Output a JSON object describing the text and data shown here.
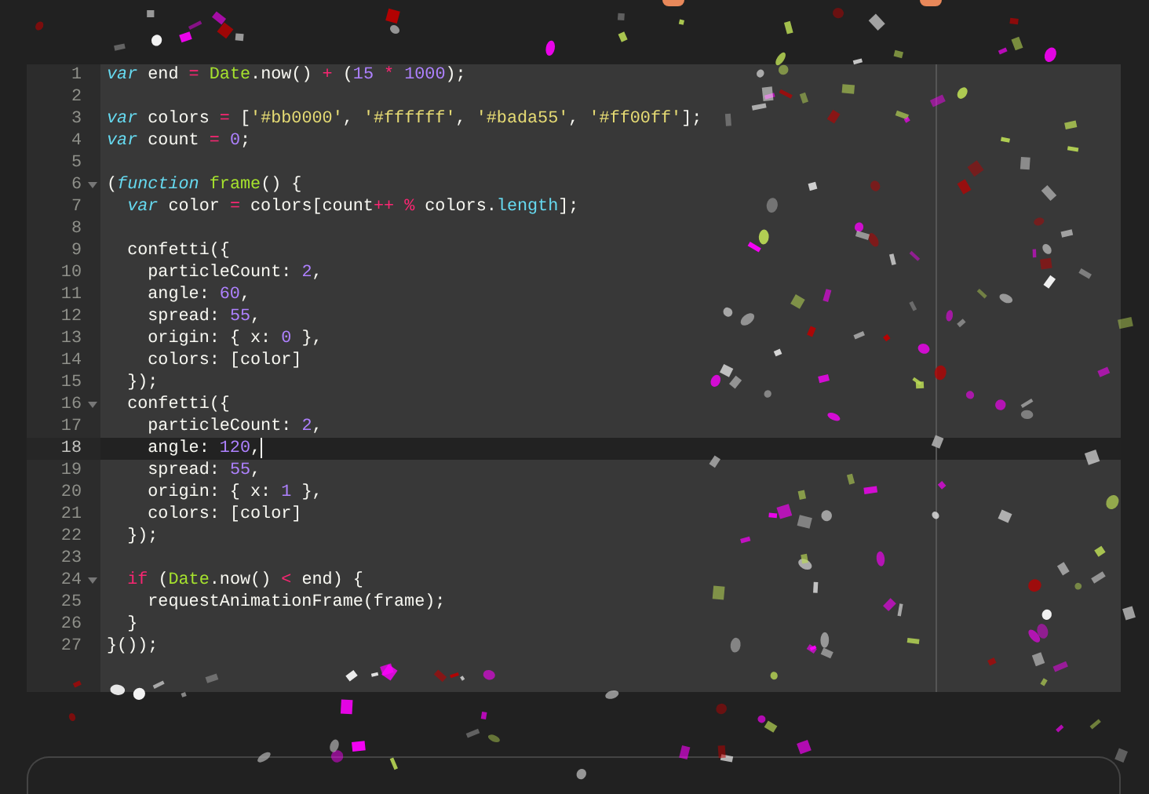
{
  "editor": {
    "lines": [
      {
        "number": "1",
        "active": false,
        "foldable": false,
        "tokens": [
          {
            "text": "var",
            "kind": "kw"
          },
          {
            "text": " end ",
            "kind": "plain"
          },
          {
            "text": "= ",
            "kind": "op"
          },
          {
            "text": "Date",
            "kind": "cls"
          },
          {
            "text": ".now() ",
            "kind": "plain"
          },
          {
            "text": "+",
            "kind": "op"
          },
          {
            "text": " (",
            "kind": "plain"
          },
          {
            "text": "15 ",
            "kind": "num"
          },
          {
            "text": "* ",
            "kind": "op"
          },
          {
            "text": "1000",
            "kind": "num"
          },
          {
            "text": ");",
            "kind": "plain"
          }
        ]
      },
      {
        "number": "2",
        "active": false,
        "foldable": false
      },
      {
        "number": "3",
        "active": false,
        "foldable": false,
        "tokens": [
          {
            "text": "var",
            "kind": "kw"
          },
          {
            "text": " colors ",
            "kind": "plain"
          },
          {
            "text": "=",
            "kind": "op"
          },
          {
            "text": " [",
            "kind": "plain"
          },
          {
            "text": "'#bb0000'",
            "kind": "str"
          },
          {
            "text": ", ",
            "kind": "plain"
          },
          {
            "text": "'#ffffff'",
            "kind": "str"
          },
          {
            "text": ", ",
            "kind": "plain"
          },
          {
            "text": "'#bada55'",
            "kind": "str"
          },
          {
            "text": ", ",
            "kind": "plain"
          },
          {
            "text": "'#ff00ff'",
            "kind": "str"
          },
          {
            "text": "];",
            "kind": "plain"
          }
        ]
      },
      {
        "number": "4",
        "active": false,
        "foldable": false,
        "tokens": [
          {
            "text": "var",
            "kind": "kw"
          },
          {
            "text": " count ",
            "kind": "plain"
          },
          {
            "text": "= ",
            "kind": "op"
          },
          {
            "text": "0",
            "kind": "num"
          },
          {
            "text": ";",
            "kind": "plain"
          }
        ]
      },
      {
        "number": "5",
        "active": false,
        "foldable": false
      },
      {
        "number": "6",
        "active": false,
        "foldable": true,
        "tokens": [
          {
            "text": "(",
            "kind": "plain"
          },
          {
            "text": "function ",
            "kind": "kw"
          },
          {
            "text": "frame",
            "kind": "fn"
          },
          {
            "text": "() {",
            "kind": "plain"
          }
        ]
      },
      {
        "number": "7",
        "active": false,
        "foldable": false,
        "tokens": [
          {
            "text": "  var",
            "kind": "kw"
          },
          {
            "text": " color ",
            "kind": "plain"
          },
          {
            "text": "=",
            "kind": "op"
          },
          {
            "text": " colors[count",
            "kind": "plain"
          },
          {
            "text": "++ ",
            "kind": "op"
          },
          {
            "text": "%",
            "kind": "op"
          },
          {
            "text": " colors.",
            "kind": "plain"
          },
          {
            "text": "length",
            "kind": "prop"
          },
          {
            "text": "];",
            "kind": "plain"
          }
        ]
      },
      {
        "number": "8",
        "active": false,
        "foldable": false
      },
      {
        "number": "9",
        "active": false,
        "foldable": false,
        "tokens": [
          {
            "text": "  confetti({",
            "kind": "plain"
          }
        ]
      },
      {
        "number": "10",
        "active": false,
        "foldable": false,
        "tokens": [
          {
            "text": "    particleCount: ",
            "kind": "plain"
          },
          {
            "text": "2",
            "kind": "num"
          },
          {
            "text": ",",
            "kind": "plain"
          }
        ]
      },
      {
        "number": "11",
        "active": false,
        "foldable": false,
        "tokens": [
          {
            "text": "    angle: ",
            "kind": "plain"
          },
          {
            "text": "60",
            "kind": "num"
          },
          {
            "text": ",",
            "kind": "plain"
          }
        ]
      },
      {
        "number": "12",
        "active": false,
        "foldable": false,
        "tokens": [
          {
            "text": "    spread: ",
            "kind": "plain"
          },
          {
            "text": "55",
            "kind": "num"
          },
          {
            "text": ",",
            "kind": "plain"
          }
        ]
      },
      {
        "number": "13",
        "active": false,
        "foldable": false,
        "tokens": [
          {
            "text": "    origin: { x: ",
            "kind": "plain"
          },
          {
            "text": "0",
            "kind": "num"
          },
          {
            "text": " },",
            "kind": "plain"
          }
        ]
      },
      {
        "number": "14",
        "active": false,
        "foldable": false,
        "tokens": [
          {
            "text": "    colors: [color]",
            "kind": "plain"
          }
        ]
      },
      {
        "number": "15",
        "active": false,
        "foldable": false,
        "tokens": [
          {
            "text": "  });",
            "kind": "plain"
          }
        ]
      },
      {
        "number": "16",
        "active": false,
        "foldable": true,
        "tokens": [
          {
            "text": "  confetti({",
            "kind": "plain"
          }
        ]
      },
      {
        "number": "17",
        "active": false,
        "foldable": false,
        "tokens": [
          {
            "text": "    particleCount: ",
            "kind": "plain"
          },
          {
            "text": "2",
            "kind": "num"
          },
          {
            "text": ",",
            "kind": "plain"
          }
        ]
      },
      {
        "number": "18",
        "active": true,
        "foldable": false,
        "tokens": [
          {
            "text": "    angle: ",
            "kind": "plain"
          },
          {
            "text": "120",
            "kind": "num"
          },
          {
            "text": ",",
            "kind": "plain"
          }
        ]
      },
      {
        "number": "19",
        "active": false,
        "foldable": false,
        "tokens": [
          {
            "text": "    spread: ",
            "kind": "plain"
          },
          {
            "text": "55",
            "kind": "num"
          },
          {
            "text": ",",
            "kind": "plain"
          }
        ]
      },
      {
        "number": "20",
        "active": false,
        "foldable": false,
        "tokens": [
          {
            "text": "    origin: { x: ",
            "kind": "plain"
          },
          {
            "text": "1",
            "kind": "num"
          },
          {
            "text": " },",
            "kind": "plain"
          }
        ]
      },
      {
        "number": "21",
        "active": false,
        "foldable": false,
        "tokens": [
          {
            "text": "    colors: [color]",
            "kind": "plain"
          }
        ]
      },
      {
        "number": "22",
        "active": false,
        "foldable": false,
        "tokens": [
          {
            "text": "  });",
            "kind": "plain"
          }
        ]
      },
      {
        "number": "23",
        "active": false,
        "foldable": false
      },
      {
        "number": "24",
        "active": false,
        "foldable": true,
        "tokens": [
          {
            "text": "  if",
            "kind": "op"
          },
          {
            "text": " (",
            "kind": "plain"
          },
          {
            "text": "Date",
            "kind": "cls"
          },
          {
            "text": ".now() ",
            "kind": "plain"
          },
          {
            "text": "<",
            "kind": "op"
          },
          {
            "text": " end) {",
            "kind": "plain"
          }
        ]
      },
      {
        "number": "25",
        "active": false,
        "foldable": false,
        "tokens": [
          {
            "text": "    requestAnimationFrame(frame);",
            "kind": "plain"
          }
        ]
      },
      {
        "number": "26",
        "active": false,
        "foldable": false,
        "tokens": [
          {
            "text": "  }",
            "kind": "plain"
          }
        ]
      },
      {
        "number": "27",
        "active": false,
        "foldable": false,
        "tokens": [
          {
            "text": "}());",
            "kind": "plain"
          }
        ]
      }
    ]
  }
}
